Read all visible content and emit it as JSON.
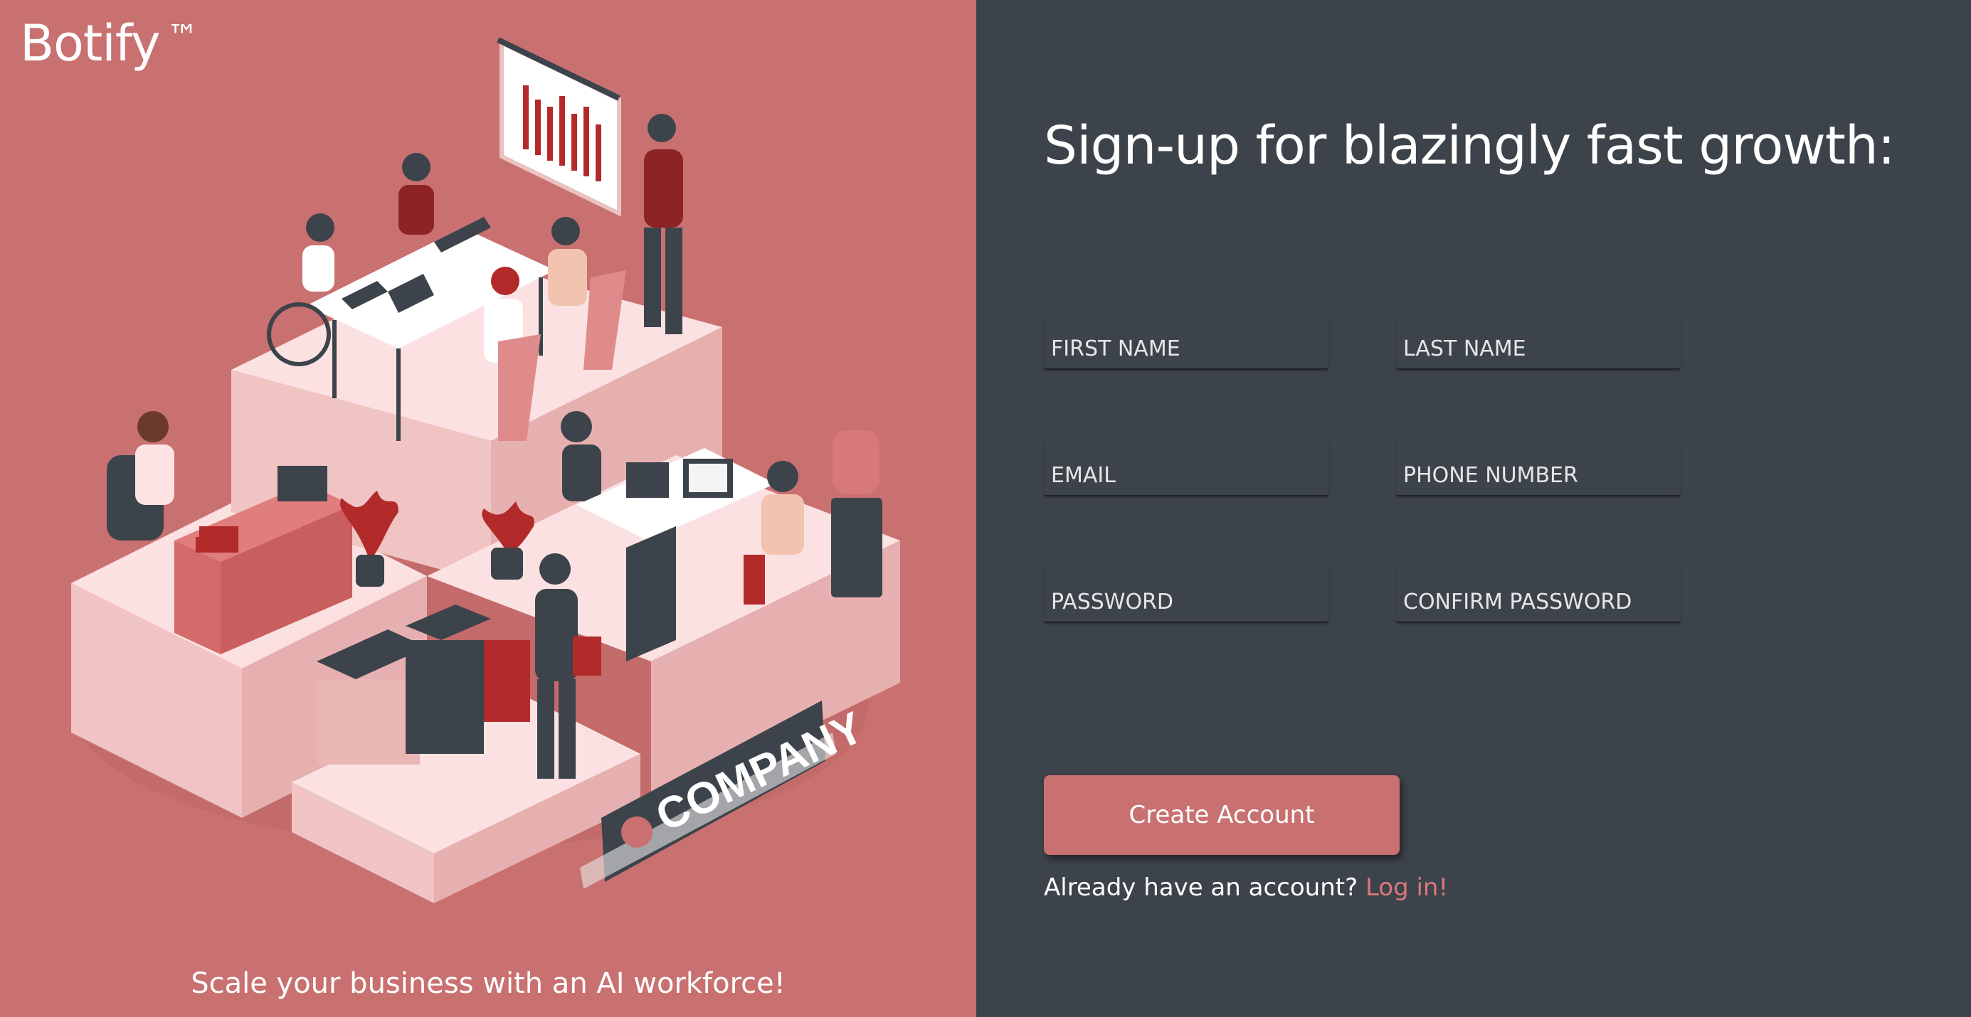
{
  "brand": {
    "name": "Botify",
    "trademark": "™"
  },
  "tagline": "Scale your business with an AI workforce!",
  "form": {
    "heading": "Sign-up for blazingly fast growth:",
    "fields": {
      "first_name": {
        "placeholder": "FIRST NAME",
        "value": ""
      },
      "last_name": {
        "placeholder": "LAST NAME",
        "value": ""
      },
      "email": {
        "placeholder": "EMAIL",
        "value": ""
      },
      "phone": {
        "placeholder": "PHONE NUMBER",
        "value": ""
      },
      "password": {
        "placeholder": "PASSWORD",
        "value": ""
      },
      "confirm_password": {
        "placeholder": "CONFIRM PASSWORD",
        "value": ""
      }
    },
    "submit_label": "Create Account",
    "login_prompt": "Already have an account?",
    "login_link": "Log in!"
  },
  "illustration": {
    "sign_text": "COMPANY",
    "icon": "office-team-illustration"
  },
  "colors": {
    "brand_accent": "#c97070",
    "panel_dark": "#3d434b",
    "link": "#d9787a"
  }
}
